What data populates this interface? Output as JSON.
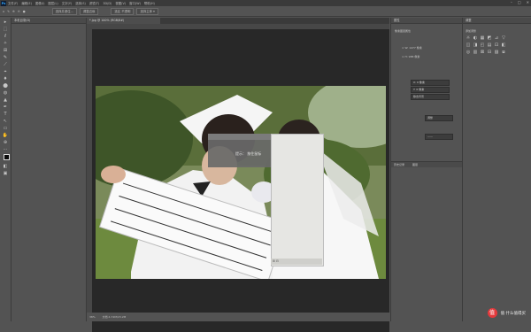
{
  "app": {
    "logo": "Ps"
  },
  "menu": [
    "文件(F)",
    "编辑(E)",
    "图像(I)",
    "图层(L)",
    "文字(Y)",
    "选择(S)",
    "滤镜(T)",
    "3D(D)",
    "视图(V)",
    "窗口(W)",
    "帮助(H)"
  ],
  "window_controls": [
    "–",
    "□",
    "✕"
  ],
  "options": {
    "button_1": "选择并遮住...",
    "button_2": "调整边缘",
    "field_1": "选区 不透明",
    "field_2": "选择主体 ▾"
  },
  "tools": [
    "▸",
    "⬚",
    "ℓ",
    "✧",
    "⊞",
    "✎",
    "⟋",
    "⌖",
    "♦",
    "⬤",
    "◍",
    "▲",
    "✒",
    "T",
    "↖",
    "▭",
    "✋",
    "⊕",
    "⋯",
    "■",
    "◧",
    "▣"
  ],
  "left_panel": {
    "tab": "本机目录(D)"
  },
  "document": {
    "tab_title": "*.jpg @ 100% (RGB/8#)",
    "status_left": "38%",
    "status_right": "文档:4.72M/23.2M"
  },
  "dialog": {
    "text": "提示：  按住鼠标"
  },
  "properties": {
    "tab": "属性",
    "subtitle": "像素图层属性",
    "row1": "∞ W: 1477 像素",
    "row2": "∞ H: 988 像素",
    "field1": "X: 0 像素",
    "field2": "Y: 0 像素",
    "field3": "移去背景",
    "field4": "调整",
    "field5": "——",
    "bottom_tab": "历史记录",
    "bottom_tab_2": "图层"
  },
  "right_strip": {
    "tab": "调整",
    "subtitle": "添加调整",
    "icon_rows": [
      [
        "☼",
        "◐",
        "▦",
        "◩",
        "⊿",
        "▽"
      ],
      [
        "◫",
        "◨",
        "◰",
        "▤",
        "⊡",
        "◧"
      ],
      [
        "◎",
        "▥",
        "⊠",
        "⊟",
        "▨",
        "⧈"
      ]
    ]
  },
  "watermark": {
    "text": "值 什么值得买"
  }
}
